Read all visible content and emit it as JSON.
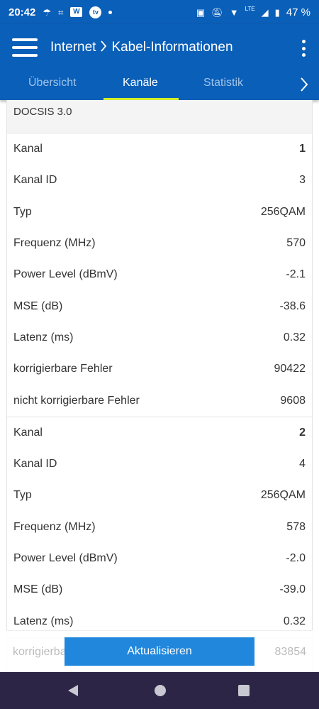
{
  "status_bar": {
    "time": "20:42",
    "icons_left": [
      "cloud-rain-icon",
      "hashtag-icon",
      "w-app-icon",
      "tv-app-icon",
      "dot-icon"
    ],
    "w_label": "W",
    "tv_label": "tv",
    "lte_label": "LTE",
    "battery": "47 %"
  },
  "app_bar": {
    "breadcrumb_root": "Internet",
    "breadcrumb_page": "Kabel-Informationen"
  },
  "tabs": [
    {
      "label": "Übersicht",
      "active": false
    },
    {
      "label": "Kanäle",
      "active": true
    },
    {
      "label": "Statistik",
      "active": false
    }
  ],
  "section": {
    "title": "DOCSIS 3.0"
  },
  "channels": [
    {
      "rows": [
        {
          "label": "Kanal",
          "value": "1"
        },
        {
          "label": "Kanal ID",
          "value": "3"
        },
        {
          "label": "Typ",
          "value": "256QAM"
        },
        {
          "label": "Frequenz (MHz)",
          "value": "570"
        },
        {
          "label": "Power Level (dBmV)",
          "value": "-2.1"
        },
        {
          "label": "MSE (dB)",
          "value": "-38.6"
        },
        {
          "label": "Latenz (ms)",
          "value": "0.32"
        },
        {
          "label": "korrigierbare Fehler",
          "value": "90422"
        },
        {
          "label": "nicht korrigierbare Fehler",
          "value": "9608"
        }
      ]
    },
    {
      "rows": [
        {
          "label": "Kanal",
          "value": "2"
        },
        {
          "label": "Kanal ID",
          "value": "4"
        },
        {
          "label": "Typ",
          "value": "256QAM"
        },
        {
          "label": "Frequenz (MHz)",
          "value": "578"
        },
        {
          "label": "Power Level (dBmV)",
          "value": "-2.0"
        },
        {
          "label": "MSE (dB)",
          "value": "-39.0"
        },
        {
          "label": "Latenz (ms)",
          "value": "0.32"
        }
      ]
    }
  ],
  "partial_row": {
    "label": "korrigierbare Fehler",
    "value": "83854"
  },
  "update_button": "Aktualisieren",
  "colors": {
    "app_bar": "#0a5fb8",
    "tab_indicator": "#d4ef2a",
    "button": "#2187dc",
    "nav_bar": "#2d2546"
  }
}
